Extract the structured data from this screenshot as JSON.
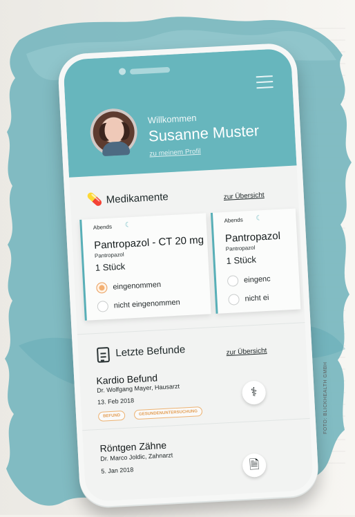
{
  "header": {
    "greeting": "Willkommen",
    "name": "Susanne Muster",
    "profile_link": "zu meinem Profil"
  },
  "medications": {
    "title": "Medikamente",
    "overview_link": "zur Übersicht",
    "cards": [
      {
        "time": "Abends",
        "name": "Pantropazol - CT 20 mg",
        "subtitle": "Pantropazol",
        "dose": "1 Stück",
        "options": [
          {
            "label": "eingenommen",
            "checked": true
          },
          {
            "label": "nicht eingenommen",
            "checked": false
          }
        ]
      },
      {
        "time": "Abends",
        "name": "Pantropazol",
        "subtitle": "Pantropazol",
        "dose": "1 Stück",
        "options": [
          {
            "label": "eingenc",
            "checked": false
          },
          {
            "label": "nicht ei",
            "checked": false
          }
        ]
      }
    ]
  },
  "findings": {
    "title": "Letzte Befunde",
    "overview_link": "zur Übersicht",
    "items": [
      {
        "title": "Kardio Befund",
        "doctor": "Dr. Wolfgang Mayer, Hausarzt",
        "date": "13. Feb 2018",
        "tags": [
          "BEFUND",
          "GESUNDENUNTERSUCHUNG"
        ]
      },
      {
        "title": "Röntgen Zähne",
        "doctor": "Dr. Marco Joldic, Zahnarzt",
        "date": "5. Jan 2018"
      }
    ]
  },
  "credit": "FOTO: BLICKHEALTH GMBH",
  "colors": {
    "teal": "#67b6bd",
    "orange": "#f3b072"
  }
}
